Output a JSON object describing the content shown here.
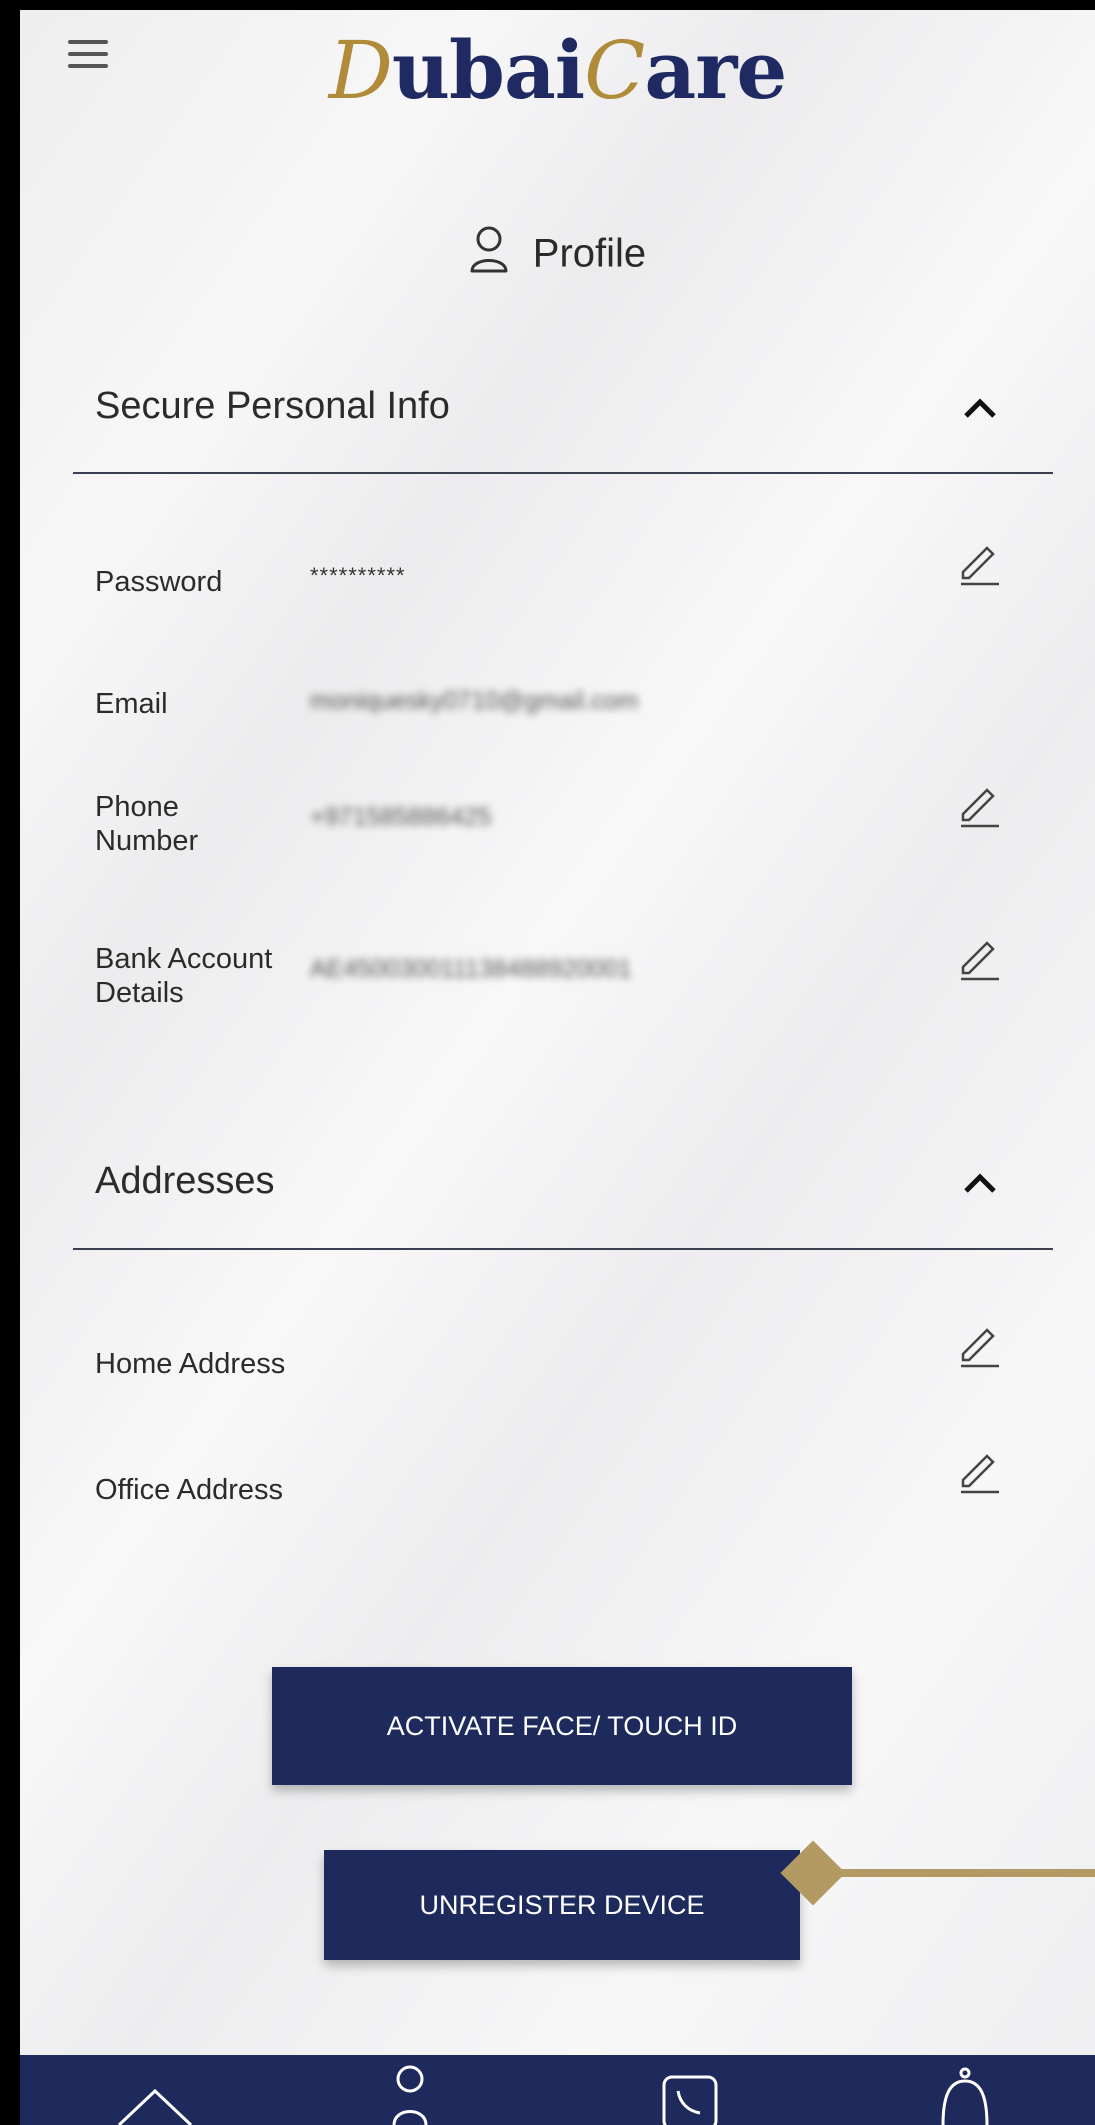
{
  "header": {
    "logo_part1": "D",
    "logo_part2": "ubai",
    "logo_part3": "C",
    "logo_part4": "are",
    "menu_icon": "hamburger-menu-icon"
  },
  "page": {
    "title": "Profile",
    "title_icon": "user-icon"
  },
  "secure_section": {
    "title": "Secure Personal Info",
    "rows": [
      {
        "label": "Password",
        "value": "**********"
      },
      {
        "label": "Email",
        "value": "moniquesky0710@gmail.com"
      },
      {
        "label_line1": "Phone",
        "label_line2": "Number",
        "value": "+971585886425"
      },
      {
        "label_line1": "Bank Account",
        "label_line2": "Details",
        "value": "AE450030011138488920001"
      }
    ]
  },
  "addresses_section": {
    "title": "Addresses",
    "rows": [
      {
        "label": "Home Address"
      },
      {
        "label": "Office Address"
      }
    ]
  },
  "buttons": {
    "activate": "ACTIVATE FACE/ TOUCH ID",
    "unregister": "UNREGISTER DEVICE"
  },
  "tabbar": {
    "items": [
      "home-icon",
      "user-icon",
      "phone-icon",
      "bell-icon"
    ]
  },
  "colors": {
    "navy": "#1f2a5c",
    "gold": "#b08c3a",
    "arrow": "#b39a62"
  }
}
